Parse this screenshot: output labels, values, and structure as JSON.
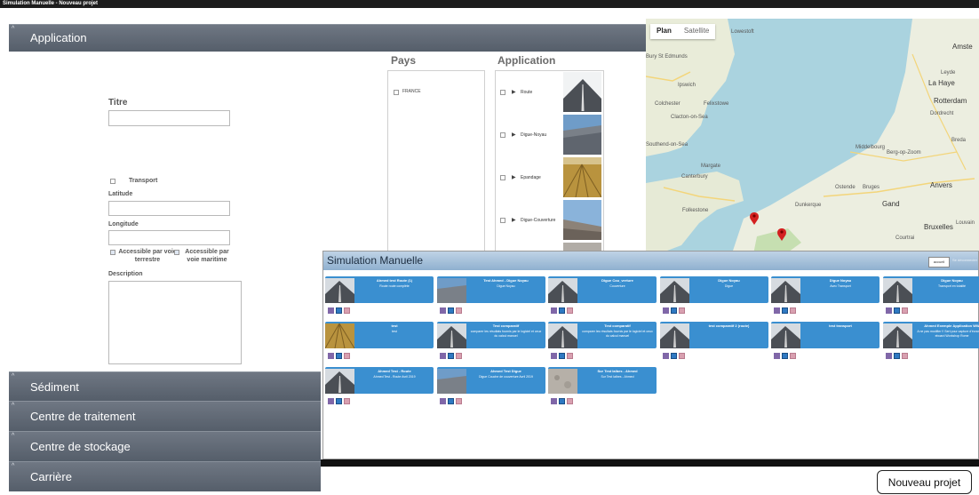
{
  "window": {
    "title": "Simulation Manuelle - Nouveau projet"
  },
  "sections": {
    "application": "Application",
    "sediment": "Sédiment",
    "centre_traitement": "Centre de traitement",
    "centre_stockage": "Centre de stockage",
    "carriere": "Carrière"
  },
  "form": {
    "titre_label": "Titre",
    "transport_label": "Transport",
    "latitude_label": "Latitude",
    "longitude_label": "Longitude",
    "access_terrestre_label": "Accessible par voie terrestre",
    "access_maritime_label": "Accessible par voie maritime",
    "description_label": "Description"
  },
  "pays": {
    "header": "Pays",
    "items": [
      "FRANCE"
    ]
  },
  "applications": {
    "header": "Application",
    "items": [
      "Route",
      "Digue-Noyau",
      "Epandage",
      "Digue-Couverture"
    ]
  },
  "map": {
    "plan_label": "Plan",
    "satellite_label": "Satellite",
    "cities": [
      "Lowestoft",
      "Amste",
      "Leyde",
      "La Haye",
      "Rotterdam",
      "Dordrecht",
      "Breda",
      "Berg-op-Zoom",
      "Ipswich",
      "Colchester",
      "Clacton-on-Sea",
      "Felixstowe",
      "Southend-on-Sea",
      "Margate",
      "Canterbury",
      "Dunkerque",
      "Ostende",
      "Bruges",
      "Anvers",
      "Gand",
      "Bruxelles",
      "Louvain",
      "Courtrai",
      "Folkestone",
      "Middelbourg",
      "Bury St Edmunds"
    ]
  },
  "sim": {
    "title": "Simulation Manuelle",
    "accueil": "accueil",
    "disconnect": "Se déconnecter"
  },
  "cards": [
    {
      "title": "Ahmed test Route (1)",
      "desc": "Route route complète",
      "thumb": "road"
    },
    {
      "title": "Test Ahmed - Digue Noyau",
      "desc": "Digue Noyau",
      "thumb": "dike"
    },
    {
      "title": "Digue Cou_verture",
      "desc": "Couverture",
      "thumb": "road"
    },
    {
      "title": "Digue Noyau",
      "desc": "Digue",
      "thumb": "road"
    },
    {
      "title": "Digue Noyau",
      "desc": "Avec Transport",
      "thumb": "road"
    },
    {
      "title": "Digue Noyau",
      "desc": "Transport en totalité",
      "thumb": "road"
    },
    {
      "title": "test",
      "desc": "test",
      "thumb": "field"
    },
    {
      "title": "Test comparatif",
      "desc": "comparer les résultats fournis par le logiciel et ceux du calcul manuel",
      "thumb": "road"
    },
    {
      "title": "Test comparatif",
      "desc": "comparer les résultats fournis par le logiciel et ceux du calcul manuel",
      "thumb": "road"
    },
    {
      "title": "test comparatif 2 (route)",
      "desc": "",
      "thumb": "road"
    },
    {
      "title": "test transport",
      "desc": "",
      "thumb": "road"
    },
    {
      "title": "Ahmed Exemple Application WW",
      "desc": "A ne pas modifier !! Sert pour capture d'écran pour eboard Workshop Rome",
      "thumb": "road"
    },
    {
      "title": "Ahmed Test - Route",
      "desc": "Ahmed Test - Route Avril 2019",
      "thumb": "road"
    },
    {
      "title": "Ahmed Test Digue",
      "desc": "Digue Couche de couverture Avril 2019",
      "thumb": "dike"
    },
    {
      "title": "Sur Test Ialbes - Ahmed",
      "desc": "Sur Test Ialbes - Ahmed",
      "thumb": "stone"
    }
  ],
  "new_project": "Nouveau projet"
}
